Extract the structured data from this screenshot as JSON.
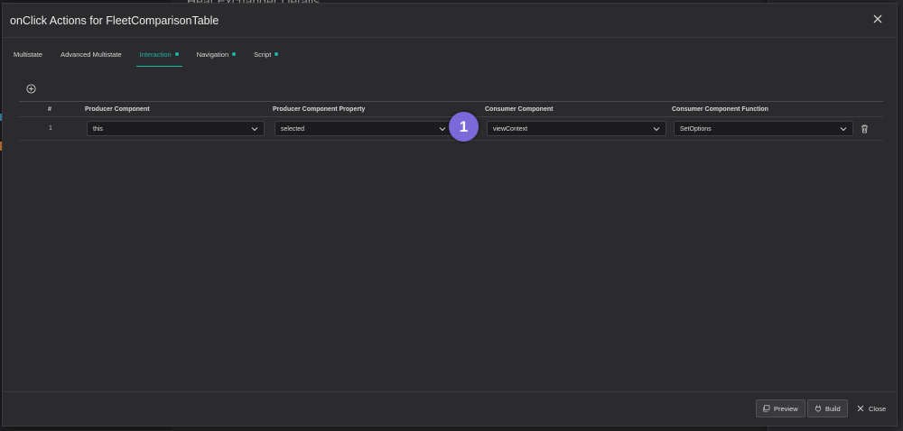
{
  "background": {
    "title": "Heat Exchanger Details"
  },
  "modal": {
    "title": "onClick Actions for FleetComparisonTable"
  },
  "tabs": [
    {
      "label": "Multistate",
      "active": false,
      "dot": false
    },
    {
      "label": "Advanced Multistate",
      "active": false,
      "dot": false
    },
    {
      "label": "Interaction",
      "active": true,
      "dot": true
    },
    {
      "label": "Navigation",
      "active": false,
      "dot": true
    },
    {
      "label": "Script",
      "active": false,
      "dot": true
    }
  ],
  "table": {
    "headers": {
      "index": "#",
      "producer_component": "Producer Component",
      "producer_property": "Producer Component Property",
      "consumer_component": "Consumer Component",
      "consumer_function": "Consumer Component Function"
    },
    "rows": [
      {
        "index": "1",
        "producer_component": "this",
        "producer_property": "selected",
        "consumer_component": "viewContext",
        "consumer_function": "SetOptions"
      }
    ]
  },
  "annotation": {
    "badge": "1"
  },
  "footer": {
    "preview_label": "Preview",
    "build_label": "Build",
    "close_label": "Close"
  },
  "colors": {
    "accent": "#19b5a8",
    "badge": "#7b68d9",
    "background": "#2b2b2e"
  }
}
